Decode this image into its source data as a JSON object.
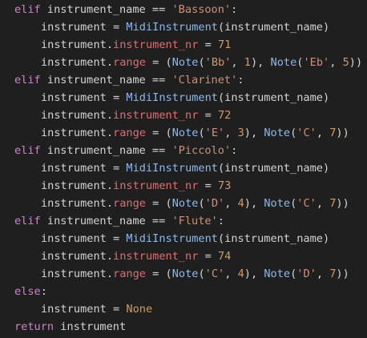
{
  "colors": {
    "background": "#1f1f1f",
    "keyword": "#c586c0",
    "plain": "#d4d4d4",
    "string": "#ce9178",
    "class": "#8fb8e8",
    "attribute": "#e06c75",
    "number": "#d19a66"
  },
  "code": {
    "lines": [
      {
        "indent": 0,
        "tokens": [
          {
            "t": "kw",
            "v": "elif"
          },
          {
            "t": "name",
            "v": " instrument_name "
          },
          {
            "t": "op",
            "v": "=="
          },
          {
            "t": "name",
            "v": " "
          },
          {
            "t": "str",
            "v": "'Bassoon'"
          },
          {
            "t": "op",
            "v": ":"
          }
        ]
      },
      {
        "indent": 1,
        "tokens": [
          {
            "t": "name",
            "v": "instrument "
          },
          {
            "t": "op",
            "v": "="
          },
          {
            "t": "name",
            "v": " "
          },
          {
            "t": "cls",
            "v": "MidiInstrument"
          },
          {
            "t": "paren",
            "v": "("
          },
          {
            "t": "name",
            "v": "instrument_name"
          },
          {
            "t": "paren",
            "v": ")"
          }
        ]
      },
      {
        "indent": 1,
        "tokens": [
          {
            "t": "name",
            "v": "instrument."
          },
          {
            "t": "attr",
            "v": "instrument_nr"
          },
          {
            "t": "name",
            "v": " "
          },
          {
            "t": "op",
            "v": "="
          },
          {
            "t": "name",
            "v": " "
          },
          {
            "t": "num",
            "v": "71"
          }
        ]
      },
      {
        "indent": 1,
        "tokens": [
          {
            "t": "name",
            "v": "instrument."
          },
          {
            "t": "attr",
            "v": "range"
          },
          {
            "t": "name",
            "v": " "
          },
          {
            "t": "op",
            "v": "="
          },
          {
            "t": "name",
            "v": " "
          },
          {
            "t": "paren",
            "v": "("
          },
          {
            "t": "cls",
            "v": "Note"
          },
          {
            "t": "paren",
            "v": "("
          },
          {
            "t": "str",
            "v": "'Bb'"
          },
          {
            "t": "op",
            "v": ", "
          },
          {
            "t": "num",
            "v": "1"
          },
          {
            "t": "paren",
            "v": ")"
          },
          {
            "t": "op",
            "v": ", "
          },
          {
            "t": "cls",
            "v": "Note"
          },
          {
            "t": "paren",
            "v": "("
          },
          {
            "t": "str",
            "v": "'Eb'"
          },
          {
            "t": "op",
            "v": ", "
          },
          {
            "t": "num",
            "v": "5"
          },
          {
            "t": "paren",
            "v": "))"
          }
        ]
      },
      {
        "indent": 0,
        "tokens": [
          {
            "t": "kw",
            "v": "elif"
          },
          {
            "t": "name",
            "v": " instrument_name "
          },
          {
            "t": "op",
            "v": "=="
          },
          {
            "t": "name",
            "v": " "
          },
          {
            "t": "str",
            "v": "'Clarinet'"
          },
          {
            "t": "op",
            "v": ":"
          }
        ]
      },
      {
        "indent": 1,
        "tokens": [
          {
            "t": "name",
            "v": "instrument "
          },
          {
            "t": "op",
            "v": "="
          },
          {
            "t": "name",
            "v": " "
          },
          {
            "t": "cls",
            "v": "MidiInstrument"
          },
          {
            "t": "paren",
            "v": "("
          },
          {
            "t": "name",
            "v": "instrument_name"
          },
          {
            "t": "paren",
            "v": ")"
          }
        ]
      },
      {
        "indent": 1,
        "tokens": [
          {
            "t": "name",
            "v": "instrument."
          },
          {
            "t": "attr",
            "v": "instrument_nr"
          },
          {
            "t": "name",
            "v": " "
          },
          {
            "t": "op",
            "v": "="
          },
          {
            "t": "name",
            "v": " "
          },
          {
            "t": "num",
            "v": "72"
          }
        ]
      },
      {
        "indent": 1,
        "tokens": [
          {
            "t": "name",
            "v": "instrument."
          },
          {
            "t": "attr",
            "v": "range"
          },
          {
            "t": "name",
            "v": " "
          },
          {
            "t": "op",
            "v": "="
          },
          {
            "t": "name",
            "v": " "
          },
          {
            "t": "paren",
            "v": "("
          },
          {
            "t": "cls",
            "v": "Note"
          },
          {
            "t": "paren",
            "v": "("
          },
          {
            "t": "str",
            "v": "'E'"
          },
          {
            "t": "op",
            "v": ", "
          },
          {
            "t": "num",
            "v": "3"
          },
          {
            "t": "paren",
            "v": ")"
          },
          {
            "t": "op",
            "v": ", "
          },
          {
            "t": "cls",
            "v": "Note"
          },
          {
            "t": "paren",
            "v": "("
          },
          {
            "t": "str",
            "v": "'C'"
          },
          {
            "t": "op",
            "v": ", "
          },
          {
            "t": "num",
            "v": "7"
          },
          {
            "t": "paren",
            "v": "))"
          }
        ]
      },
      {
        "indent": 0,
        "tokens": [
          {
            "t": "kw",
            "v": "elif"
          },
          {
            "t": "name",
            "v": " instrument_name "
          },
          {
            "t": "op",
            "v": "=="
          },
          {
            "t": "name",
            "v": " "
          },
          {
            "t": "str",
            "v": "'Piccolo'"
          },
          {
            "t": "op",
            "v": ":"
          }
        ]
      },
      {
        "indent": 1,
        "tokens": [
          {
            "t": "name",
            "v": "instrument "
          },
          {
            "t": "op",
            "v": "="
          },
          {
            "t": "name",
            "v": " "
          },
          {
            "t": "cls",
            "v": "MidiInstrument"
          },
          {
            "t": "paren",
            "v": "("
          },
          {
            "t": "name",
            "v": "instrument_name"
          },
          {
            "t": "paren",
            "v": ")"
          }
        ]
      },
      {
        "indent": 1,
        "tokens": [
          {
            "t": "name",
            "v": "instrument."
          },
          {
            "t": "attr",
            "v": "instrument_nr"
          },
          {
            "t": "name",
            "v": " "
          },
          {
            "t": "op",
            "v": "="
          },
          {
            "t": "name",
            "v": " "
          },
          {
            "t": "num",
            "v": "73"
          }
        ]
      },
      {
        "indent": 1,
        "tokens": [
          {
            "t": "name",
            "v": "instrument."
          },
          {
            "t": "attr",
            "v": "range"
          },
          {
            "t": "name",
            "v": " "
          },
          {
            "t": "op",
            "v": "="
          },
          {
            "t": "name",
            "v": " "
          },
          {
            "t": "paren",
            "v": "("
          },
          {
            "t": "cls",
            "v": "Note"
          },
          {
            "t": "paren",
            "v": "("
          },
          {
            "t": "str",
            "v": "'D'"
          },
          {
            "t": "op",
            "v": ", "
          },
          {
            "t": "num",
            "v": "4"
          },
          {
            "t": "paren",
            "v": ")"
          },
          {
            "t": "op",
            "v": ", "
          },
          {
            "t": "cls",
            "v": "Note"
          },
          {
            "t": "paren",
            "v": "("
          },
          {
            "t": "str",
            "v": "'C'"
          },
          {
            "t": "op",
            "v": ", "
          },
          {
            "t": "num",
            "v": "7"
          },
          {
            "t": "paren",
            "v": "))"
          }
        ]
      },
      {
        "indent": 0,
        "tokens": [
          {
            "t": "kw",
            "v": "elif"
          },
          {
            "t": "name",
            "v": " instrument_name "
          },
          {
            "t": "op",
            "v": "=="
          },
          {
            "t": "name",
            "v": " "
          },
          {
            "t": "str",
            "v": "'Flute'"
          },
          {
            "t": "op",
            "v": ":"
          }
        ]
      },
      {
        "indent": 1,
        "tokens": [
          {
            "t": "name",
            "v": "instrument "
          },
          {
            "t": "op",
            "v": "="
          },
          {
            "t": "name",
            "v": " "
          },
          {
            "t": "cls",
            "v": "MidiInstrument"
          },
          {
            "t": "paren",
            "v": "("
          },
          {
            "t": "name",
            "v": "instrument_name"
          },
          {
            "t": "paren",
            "v": ")"
          }
        ]
      },
      {
        "indent": 1,
        "tokens": [
          {
            "t": "name",
            "v": "instrument."
          },
          {
            "t": "attr",
            "v": "instrument_nr"
          },
          {
            "t": "name",
            "v": " "
          },
          {
            "t": "op",
            "v": "="
          },
          {
            "t": "name",
            "v": " "
          },
          {
            "t": "num",
            "v": "74"
          }
        ]
      },
      {
        "indent": 1,
        "tokens": [
          {
            "t": "name",
            "v": "instrument."
          },
          {
            "t": "attr",
            "v": "range"
          },
          {
            "t": "name",
            "v": " "
          },
          {
            "t": "op",
            "v": "="
          },
          {
            "t": "name",
            "v": " "
          },
          {
            "t": "paren",
            "v": "("
          },
          {
            "t": "cls",
            "v": "Note"
          },
          {
            "t": "paren",
            "v": "("
          },
          {
            "t": "str",
            "v": "'C'"
          },
          {
            "t": "op",
            "v": ", "
          },
          {
            "t": "num",
            "v": "4"
          },
          {
            "t": "paren",
            "v": ")"
          },
          {
            "t": "op",
            "v": ", "
          },
          {
            "t": "cls",
            "v": "Note"
          },
          {
            "t": "paren",
            "v": "("
          },
          {
            "t": "str",
            "v": "'D'"
          },
          {
            "t": "op",
            "v": ", "
          },
          {
            "t": "num",
            "v": "7"
          },
          {
            "t": "paren",
            "v": "))"
          }
        ]
      },
      {
        "indent": 0,
        "tokens": [
          {
            "t": "kw",
            "v": "else"
          },
          {
            "t": "op",
            "v": ":"
          }
        ]
      },
      {
        "indent": 1,
        "tokens": [
          {
            "t": "name",
            "v": "instrument "
          },
          {
            "t": "op",
            "v": "="
          },
          {
            "t": "name",
            "v": " "
          },
          {
            "t": "const",
            "v": "None"
          }
        ]
      },
      {
        "indent": 0,
        "tokens": [
          {
            "t": "kw",
            "v": "return"
          },
          {
            "t": "name",
            "v": " instrument"
          }
        ]
      }
    ]
  }
}
